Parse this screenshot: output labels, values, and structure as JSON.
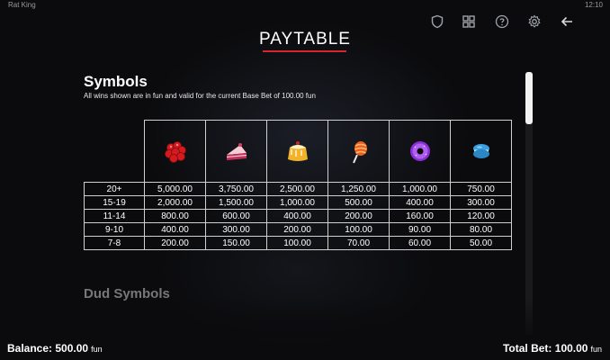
{
  "statusbar": {
    "app_name": "Rat King",
    "time": "12:10"
  },
  "header_icons": [
    "shield-icon",
    "grid-icon",
    "help-icon",
    "gear-icon",
    "back-arrow-icon"
  ],
  "title": "PAYTABLE",
  "accent_color": "#d6262b",
  "symbols_section": {
    "title": "Symbols",
    "subtitle": "All wins shown are in fun and valid for the current Base Bet of 100.00 fun",
    "symbol_icons": [
      "raspberry-icon",
      "cake-slice-icon",
      "pudding-icon",
      "lollipop-icon",
      "donut-icon",
      "macaron-icon"
    ],
    "rows": [
      {
        "label": "20+",
        "values": [
          "5,000.00",
          "3,750.00",
          "2,500.00",
          "1,250.00",
          "1,000.00",
          "750.00"
        ]
      },
      {
        "label": "15-19",
        "values": [
          "2,000.00",
          "1,500.00",
          "1,000.00",
          "500.00",
          "400.00",
          "300.00"
        ]
      },
      {
        "label": "11-14",
        "values": [
          "800.00",
          "600.00",
          "400.00",
          "200.00",
          "160.00",
          "120.00"
        ]
      },
      {
        "label": "9-10",
        "values": [
          "400.00",
          "300.00",
          "200.00",
          "100.00",
          "90.00",
          "80.00"
        ]
      },
      {
        "label": "7-8",
        "values": [
          "200.00",
          "150.00",
          "100.00",
          "70.00",
          "60.00",
          "50.00"
        ]
      }
    ]
  },
  "dud_section": {
    "title": "Dud Symbols"
  },
  "footer": {
    "balance_label": "Balance:",
    "balance_value": "500.00",
    "balance_unit": "fun",
    "total_bet_label": "Total Bet:",
    "total_bet_value": "100.00",
    "total_bet_unit": "fun"
  }
}
